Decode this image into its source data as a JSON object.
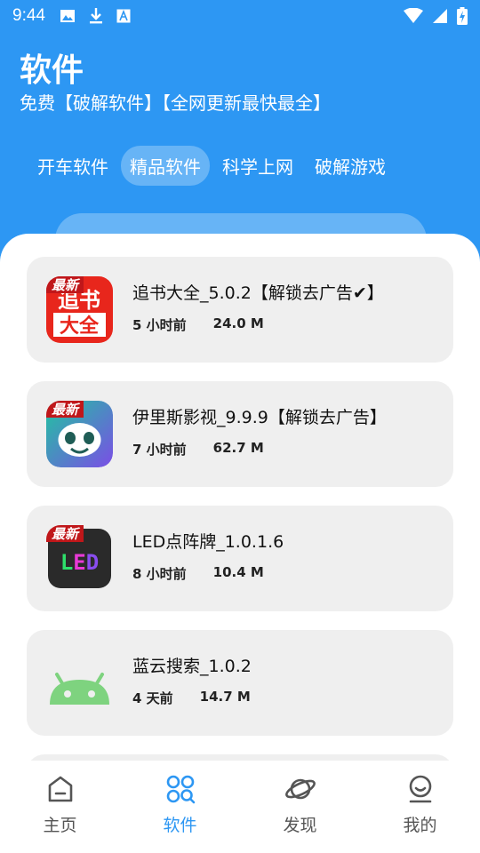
{
  "status_bar": {
    "time": "9:44"
  },
  "header": {
    "title": "软件",
    "subtitle": "免费【破解软件】【全网更新最快最全】"
  },
  "tabs": [
    {
      "label": "开车软件",
      "active": false
    },
    {
      "label": "精品软件",
      "active": true
    },
    {
      "label": "科学上网",
      "active": false
    },
    {
      "label": "破解游戏",
      "active": false
    }
  ],
  "apps": [
    {
      "name": "追书大全_5.0.2【解锁去广告✔】",
      "time": "5 小时前",
      "size": "24.0 M",
      "badge": "最新",
      "icon_text": "追书大全",
      "icon": "book-app-icon"
    },
    {
      "name": "伊里斯影视_9.9.9【解锁去广告】",
      "time": "7 小时前",
      "size": "62.7 M",
      "badge": "最新",
      "icon": "panda-app-icon"
    },
    {
      "name": "LED点阵牌_1.0.1.6",
      "time": "8 小时前",
      "size": "10.4 M",
      "badge": "最新",
      "icon_text": "LED",
      "icon": "led-app-icon"
    },
    {
      "name": "蓝云搜索_1.0.2",
      "time": "4 天前",
      "size": "14.7 M",
      "icon": "android-icon"
    }
  ],
  "bottom_nav": [
    {
      "label": "主页",
      "icon": "home-icon",
      "active": false
    },
    {
      "label": "软件",
      "icon": "apps-icon",
      "active": true
    },
    {
      "label": "发现",
      "icon": "planet-icon",
      "active": false
    },
    {
      "label": "我的",
      "icon": "profile-icon",
      "active": false
    }
  ],
  "colors": {
    "accent": "#2d97f3",
    "card": "#efefef"
  }
}
